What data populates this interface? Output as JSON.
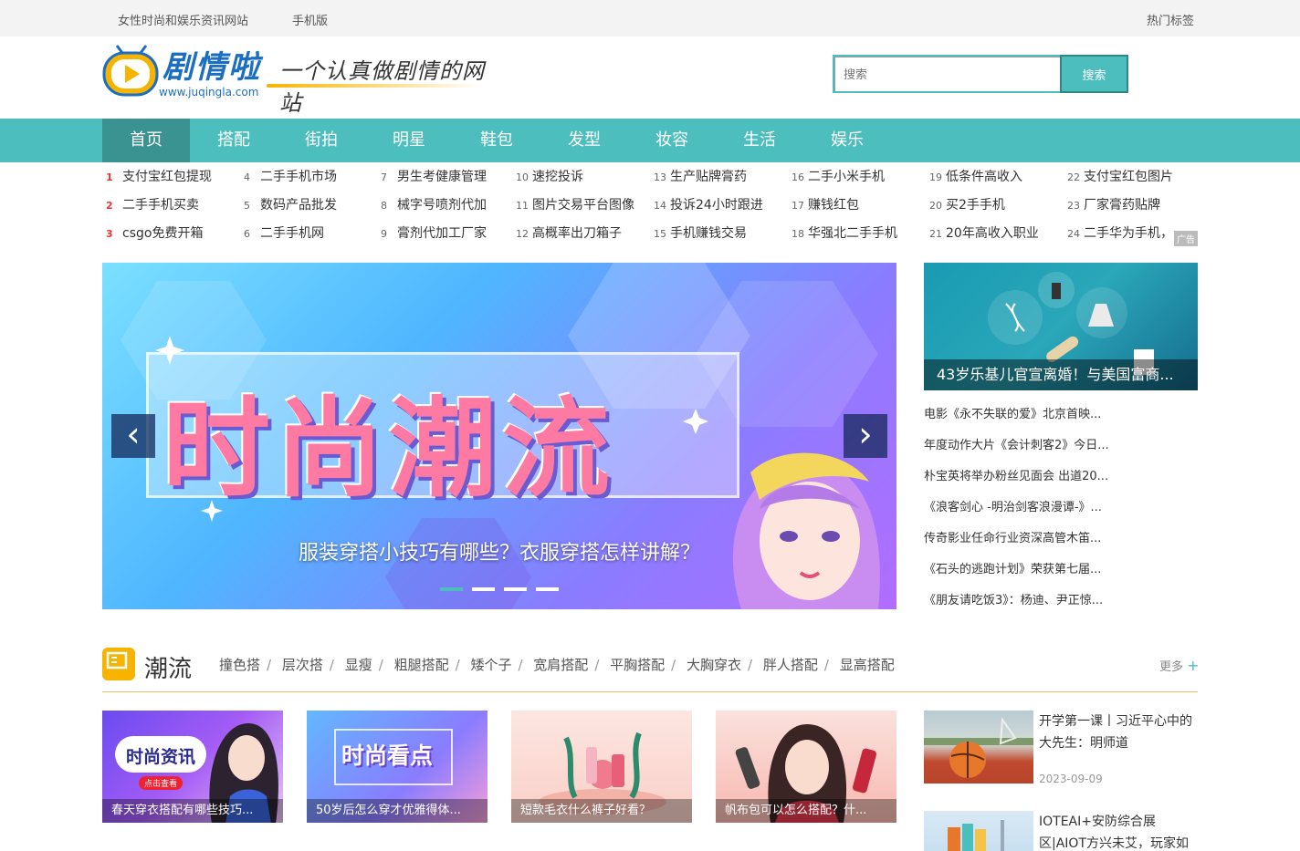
{
  "topbar": {
    "site_desc": "女性时尚和娱乐资讯网站",
    "mobile": "手机版",
    "hot_tags": "热门标签"
  },
  "logo": {
    "title": "剧情啦",
    "slogan": "一个认真做剧情的网站",
    "url": "www.juqingla.com"
  },
  "search": {
    "placeholder": "搜索",
    "button": "搜索"
  },
  "nav": [
    "首页",
    "搭配",
    "街拍",
    "明星",
    "鞋包",
    "发型",
    "妆容",
    "生活",
    "娱乐"
  ],
  "hot_list": [
    {
      "n": "1",
      "t": "支付宝红包提现"
    },
    {
      "n": "2",
      "t": "二手手机买卖"
    },
    {
      "n": "3",
      "t": "csgo免费开箱"
    },
    {
      "n": "4",
      "t": "二手手机市场"
    },
    {
      "n": "5",
      "t": "数码产品批发"
    },
    {
      "n": "6",
      "t": "二手手机网"
    },
    {
      "n": "7",
      "t": "男生考健康管理"
    },
    {
      "n": "8",
      "t": "械字号喷剂代加"
    },
    {
      "n": "9",
      "t": "膏剂代加工厂家"
    },
    {
      "n": "10",
      "t": "速挖投诉"
    },
    {
      "n": "11",
      "t": "图片交易平台图像"
    },
    {
      "n": "12",
      "t": "高概率出刀箱子"
    },
    {
      "n": "13",
      "t": "生产贴牌膏药"
    },
    {
      "n": "14",
      "t": "投诉24小时跟进"
    },
    {
      "n": "15",
      "t": "手机赚钱交易"
    },
    {
      "n": "16",
      "t": "二手小米手机"
    },
    {
      "n": "17",
      "t": "赚钱红包"
    },
    {
      "n": "18",
      "t": "华强北二手手机"
    },
    {
      "n": "19",
      "t": "低条件高收入"
    },
    {
      "n": "20",
      "t": "买2手手机"
    },
    {
      "n": "21",
      "t": "20年高收入职业"
    },
    {
      "n": "22",
      "t": "支付宝红包图片"
    },
    {
      "n": "23",
      "t": "厂家膏药贴牌"
    },
    {
      "n": "24",
      "t": "二手华为手机，"
    }
  ],
  "ad_label": "广告",
  "carousel": {
    "banner_text": "时尚潮流",
    "caption": "服装穿搭小技巧有哪些？衣服穿搭怎样讲解？",
    "prev": "‹",
    "next": "›"
  },
  "feature": {
    "caption": "43岁乐基儿官宣离婚！与美国富商..."
  },
  "news": [
    "电影《永不失联的爱》北京首映...",
    "年度动作大片《会计刺客2》今日...",
    "朴宝英将举办粉丝见面会 出道20...",
    "《浪客剑心 -明治剑客浪漫谭-》...",
    "传奇影业任命行业资深高管木笛...",
    "《石头的逃跑计划》荣获第七届...",
    "《朋友请吃饭3》：杨迪、尹正惊..."
  ],
  "section": {
    "title": "潮流",
    "links": [
      "撞色搭",
      "层次搭",
      "显瘦",
      "粗腿搭配",
      "矮个子",
      "宽肩搭配",
      "平胸搭配",
      "大胸穿衣",
      "胖人搭配",
      "显高搭配"
    ],
    "more": "更多"
  },
  "cards": [
    {
      "label": "时尚资讯",
      "sub": "点击查看",
      "caption": "春天穿衣搭配有哪些技巧..."
    },
    {
      "label": "时尚看点",
      "sub": "",
      "caption": "50岁后怎么穿才优雅得体..."
    },
    {
      "label": "",
      "sub": "",
      "caption": "短款毛衣什么裤子好看？"
    },
    {
      "label": "",
      "sub": "",
      "caption": "帆布包可以怎么搭配？什..."
    }
  ],
  "side_cards": [
    {
      "title": "开学第一课丨习近平心中的大先生：明师道",
      "date": "2023-09-09"
    },
    {
      "title": "IOTEAI+安防综合展区|AIOT方兴未艾，玩家如",
      "date": ""
    }
  ],
  "colors": {
    "accent": "#4bbebd",
    "accent_dark": "#3a9391",
    "brand_yellow": "#f6b400"
  }
}
